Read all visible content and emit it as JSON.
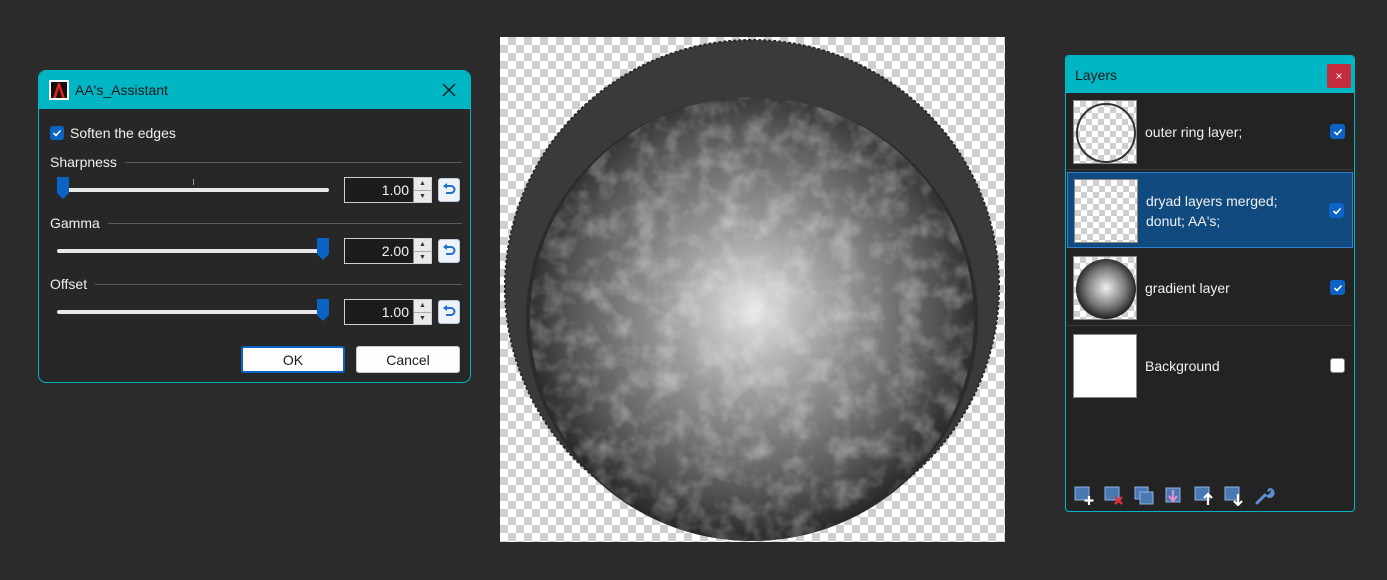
{
  "dialog": {
    "title": "AA's_Assistant",
    "soften_label": "Soften the edges",
    "soften_checked": true,
    "sharpness": {
      "label": "Sharpness",
      "value": "1.00",
      "level": 0.0
    },
    "gamma": {
      "label": "Gamma",
      "value": "2.00",
      "level": 1.0
    },
    "offset": {
      "label": "Offset",
      "value": "1.00",
      "level": 1.0
    },
    "ok_label": "OK",
    "cancel_label": "Cancel"
  },
  "layers": {
    "title": "Layers",
    "close_symbol": "×",
    "items": [
      {
        "name": "outer ring layer;",
        "visible": true,
        "selected": false,
        "thumb": "ring"
      },
      {
        "name": "dryad layers merged; donut; AA's;",
        "visible": true,
        "selected": true,
        "thumb": "transparent"
      },
      {
        "name": "gradient layer",
        "visible": true,
        "selected": false,
        "thumb": "gradient"
      },
      {
        "name": "Background",
        "visible": false,
        "selected": false,
        "thumb": "white"
      }
    ],
    "toolbar": [
      "add-layer-icon",
      "delete-layer-icon",
      "duplicate-layer-icon",
      "merge-layer-down-icon",
      "move-layer-up-icon",
      "move-layer-down-icon",
      "layer-properties-icon"
    ]
  },
  "colors": {
    "accent": "#00b6c4",
    "selection": "#114a7e",
    "checkbox": "#0b63c6",
    "close_red": "#c42b3c"
  }
}
